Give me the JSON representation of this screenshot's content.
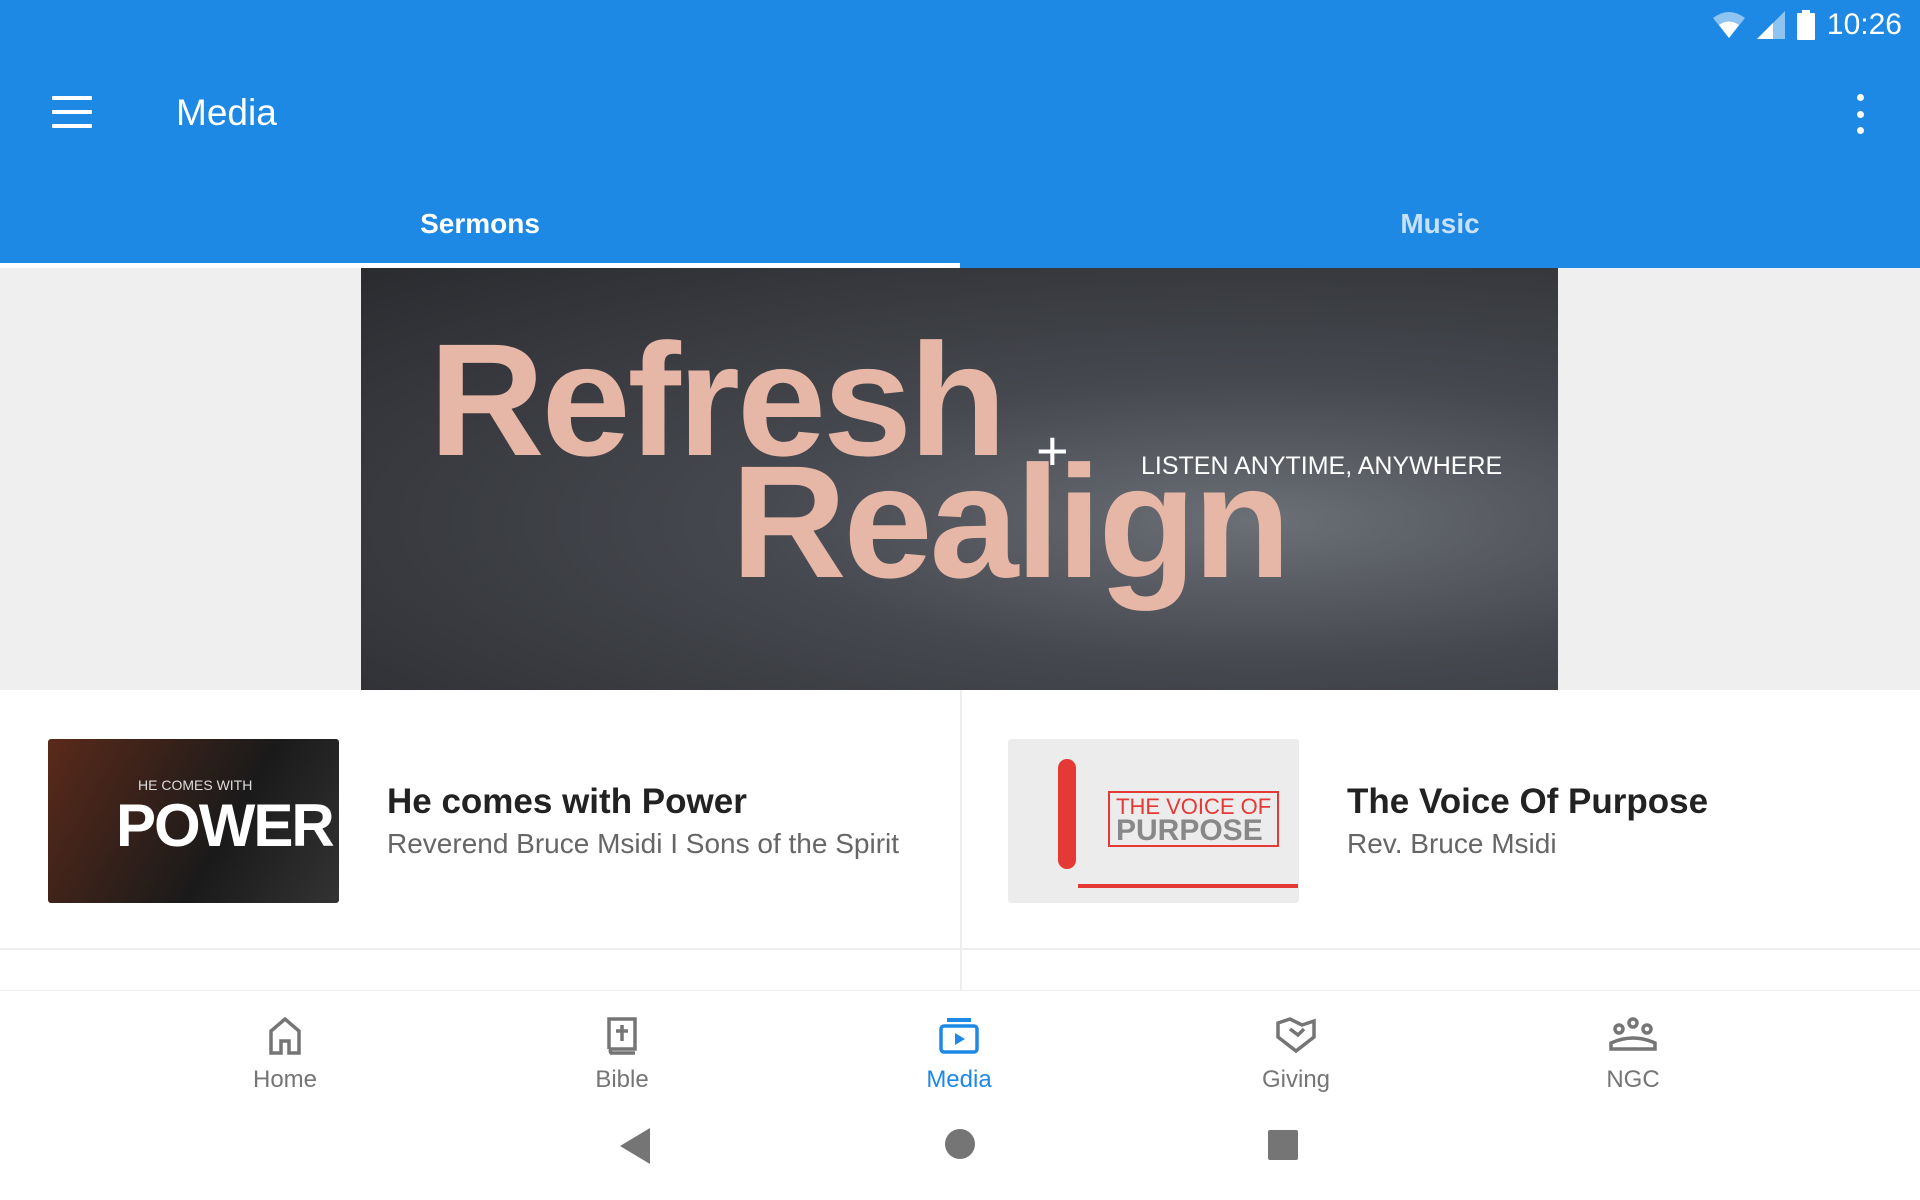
{
  "status_bar": {
    "time": "10:26",
    "icons": [
      "wifi-icon",
      "signal-icon",
      "battery-icon"
    ]
  },
  "app_bar": {
    "title": "Media",
    "menu_icon": "menu-icon",
    "more_icon": "more-vert-icon"
  },
  "tabs": [
    {
      "label": "Sermons",
      "selected": true
    },
    {
      "label": "Music",
      "selected": false
    }
  ],
  "banner": {
    "line1": "Refresh",
    "plus": "+",
    "line2": "Realign",
    "tagline": "LISTEN ANYTIME, ANYWHERE"
  },
  "sermons": [
    {
      "title": "He comes with Power",
      "subtitle": "Reverend Bruce Msidi I Sons of the Spirit",
      "thumb_text": [
        "HE COMES WITH",
        "POWER"
      ]
    },
    {
      "title": "The Voice Of Purpose",
      "subtitle": "Rev. Bruce Msidi",
      "thumb_text": [
        "THE VOICE OF",
        "PURPOSE"
      ]
    }
  ],
  "bottom_nav": [
    {
      "label": "Home",
      "icon": "home-icon"
    },
    {
      "label": "Bible",
      "icon": "bible-icon"
    },
    {
      "label": "Media",
      "icon": "media-icon",
      "selected": true
    },
    {
      "label": "Giving",
      "icon": "giving-icon"
    },
    {
      "label": "NGC",
      "icon": "group-icon"
    }
  ],
  "colors": {
    "primary": "#1e88e5",
    "inactive": "#757575",
    "banner_text": "#e6b7a7"
  }
}
